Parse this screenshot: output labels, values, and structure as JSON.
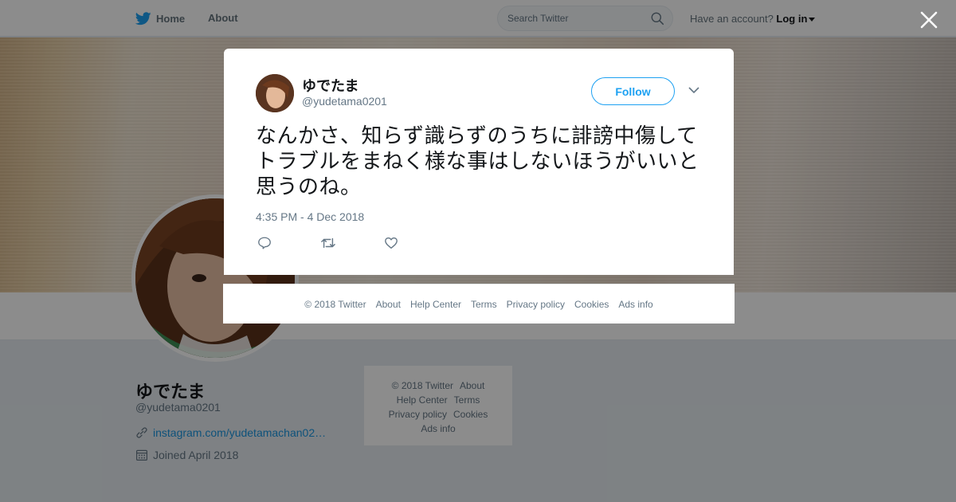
{
  "nav": {
    "home_label": "Home",
    "about_label": "About",
    "search_placeholder": "Search Twitter",
    "account_prompt": "Have an account?",
    "login_label": "Log in"
  },
  "tweet": {
    "display_name": "ゆでたま",
    "handle": "@yudetama0201",
    "follow_label": "Follow",
    "text": "なんかさ、知らず識らずのうちに誹謗中傷してトラブルをまねく様な事はしないほうがいいと思うのね。",
    "timestamp": "4:35 PM - 4 Dec 2018"
  },
  "modal_footer": {
    "copyright": "© 2018 Twitter",
    "links": [
      "About",
      "Help Center",
      "Terms",
      "Privacy policy",
      "Cookies",
      "Ads info"
    ]
  },
  "profile": {
    "name": "ゆでたま",
    "handle": "@yudetama0201",
    "link": "instagram.com/yudetamachan02…",
    "joined": "Joined April 2018"
  },
  "side_footer": {
    "copyright": "© 2018 Twitter",
    "links": [
      "About",
      "Help Center",
      "Terms",
      "Privacy policy",
      "Cookies",
      "Ads info"
    ]
  },
  "colors": {
    "accent": "#1da1f2",
    "link": "#1b95e0",
    "secondary_text": "#657786"
  }
}
